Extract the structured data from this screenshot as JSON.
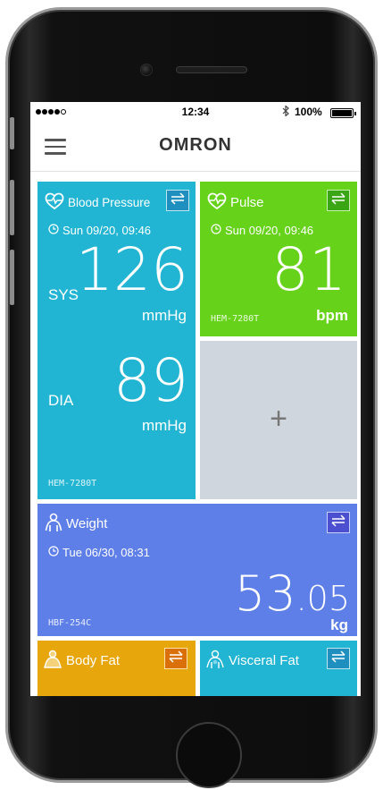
{
  "status_bar": {
    "time": "12:34",
    "battery_percent": "100%",
    "bluetooth_icon": "bluetooth-icon"
  },
  "header": {
    "logo": "OMRON",
    "menu_icon": "hamburger-menu-icon"
  },
  "tiles": {
    "blood_pressure": {
      "title": "Blood Pressure",
      "date": "Sun 09/20, 09:46",
      "sys_label": "SYS",
      "sys_value": "126",
      "sys_unit": "mmHg",
      "dia_label": "DIA",
      "dia_value": "89",
      "dia_unit": "mmHg",
      "device": "HEM-7280T",
      "color": "#21b5d3"
    },
    "pulse": {
      "title": "Pulse",
      "date": "Sun 09/20, 09:46",
      "value": "81",
      "unit": "bpm",
      "device": "HEM-7280T",
      "color": "#66d21a"
    },
    "add": {
      "symbol": "+"
    },
    "weight": {
      "title": "Weight",
      "date": "Tue 06/30, 08:31",
      "value_int": "53",
      "value_dec": ".05",
      "unit": "kg",
      "device": "HBF-254C",
      "color": "#5e7fe8"
    },
    "body_fat": {
      "title": "Body Fat",
      "color": "#e8a60d"
    },
    "visceral_fat": {
      "title": "Visceral Fat",
      "color": "#21b5d3"
    }
  }
}
